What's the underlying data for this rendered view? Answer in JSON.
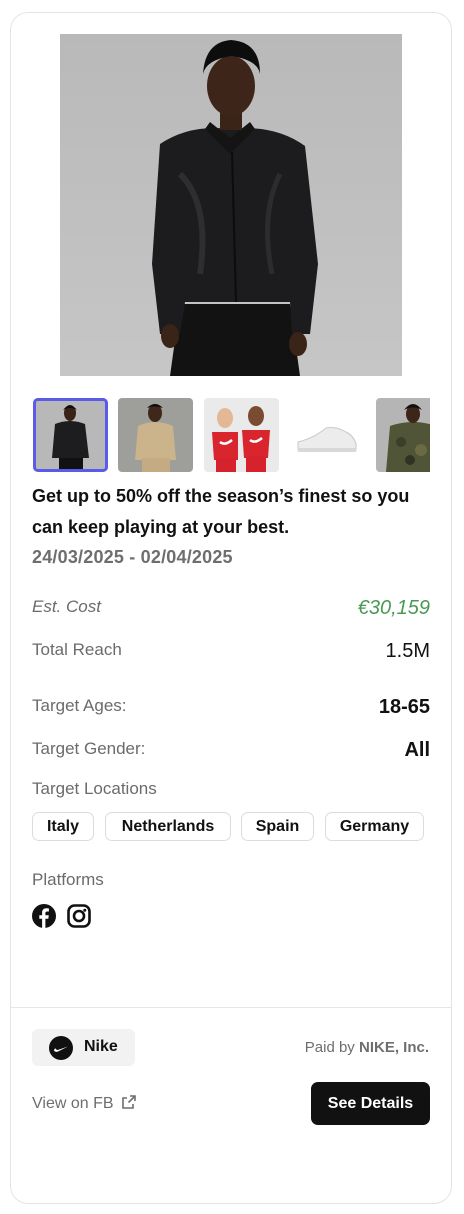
{
  "ad": {
    "headline": "Get up to 50% off the season’s finest so you can keep playing at your best.",
    "date_range": "24/03/2025 - 02/04/2025"
  },
  "media": {
    "selected_index": 0,
    "thumbnails": [
      "black-bomber-jacket",
      "beige-jacket-outfit",
      "kids-red-tees",
      "white-sneaker",
      "camo-jacket"
    ]
  },
  "stats": {
    "est_cost_label": "Est. Cost",
    "est_cost_value": "€30,159",
    "reach_label": "Total Reach",
    "reach_value": "1.5M",
    "ages_label": "Target Ages:",
    "ages_value": "18-65",
    "gender_label": "Target Gender:",
    "gender_value": "All"
  },
  "locations": {
    "label": "Target Locations",
    "items": [
      "Italy",
      "Netherlands",
      "Spain",
      "Germany"
    ]
  },
  "platforms": {
    "label": "Platforms",
    "icons": [
      "facebook-icon",
      "instagram-icon"
    ]
  },
  "footer": {
    "brand_name": "Nike",
    "paid_prefix": "Paid by",
    "paid_by": "NIKE, Inc.",
    "view_link": "View on FB",
    "details_button": "See Details"
  },
  "colors": {
    "accent_selected": "#5b5bea",
    "cost_green": "#4a9a55",
    "button_bg": "#111111"
  }
}
